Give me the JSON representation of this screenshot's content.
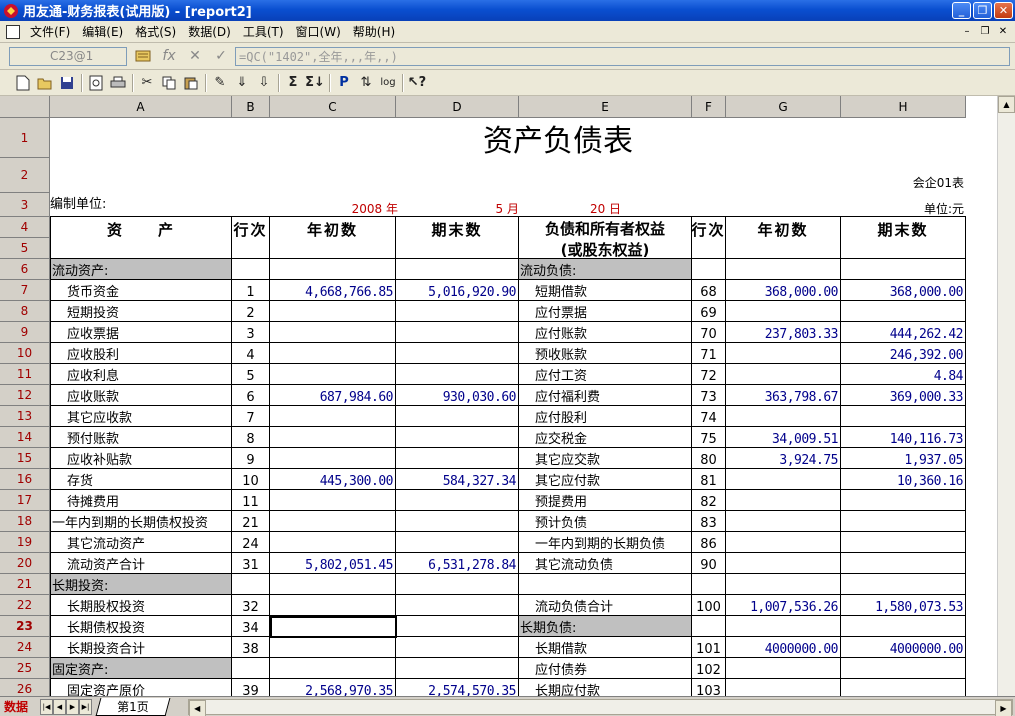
{
  "window": {
    "title": "用友通-财务报表(试用版) - [report2]",
    "buttons": [
      "_",
      "❐",
      "✕"
    ]
  },
  "menu": {
    "items": [
      "文件(F)",
      "编辑(E)",
      "格式(S)",
      "数据(D)",
      "工具(T)",
      "窗口(W)",
      "帮助(H)"
    ],
    "mdi_buttons": [
      "–",
      "❐",
      "✕"
    ]
  },
  "formula": {
    "cell_ref": "C23@1",
    "text": "=QC(\"1402\",全年,,,年,,)"
  },
  "sheet": {
    "columns": [
      "A",
      "B",
      "C",
      "D",
      "E",
      "F",
      "G",
      "H"
    ],
    "report_title": "资产负债表",
    "form_code": "会企01表",
    "unit_label": "编制单位:",
    "year": "2008 年",
    "month": "5 月",
    "day": "20 日",
    "currency_unit": "单位:元",
    "headers": {
      "assets": "资　　产",
      "line_no": "行次",
      "opening": "年初数",
      "closing": "期末数",
      "liabilities_line1": "负债和所有者权益",
      "liabilities_line2": "(或股东权益)"
    },
    "rows": [
      {
        "r": "6",
        "a": "流动资产:",
        "a_sec": true,
        "e": "流动负债:",
        "e_sec": true
      },
      {
        "r": "7",
        "a": "货币资金",
        "b": "1",
        "c": "4,668,766.85",
        "d": "5,016,920.90",
        "e": "短期借款",
        "f": "68",
        "g": "368,000.00",
        "h": "368,000.00"
      },
      {
        "r": "8",
        "a": "短期投资",
        "b": "2",
        "e": "应付票据",
        "f": "69"
      },
      {
        "r": "9",
        "a": "应收票据",
        "b": "3",
        "e": "应付账款",
        "f": "70",
        "g": "237,803.33",
        "h": "444,262.42"
      },
      {
        "r": "10",
        "a": "应收股利",
        "b": "4",
        "e": "预收账款",
        "f": "71",
        "h": "246,392.00"
      },
      {
        "r": "11",
        "a": "应收利息",
        "b": "5",
        "e": "应付工资",
        "f": "72",
        "h": "4.84"
      },
      {
        "r": "12",
        "a": "应收账款",
        "b": "6",
        "c": "687,984.60",
        "d": "930,030.60",
        "e": "应付福利费",
        "f": "73",
        "g": "363,798.67",
        "h": "369,000.33"
      },
      {
        "r": "13",
        "a": "其它应收款",
        "b": "7",
        "e": "应付股利",
        "f": "74"
      },
      {
        "r": "14",
        "a": "预付账款",
        "b": "8",
        "e": "应交税金",
        "f": "75",
        "g": "34,009.51",
        "h": "140,116.73"
      },
      {
        "r": "15",
        "a": "应收补贴款",
        "b": "9",
        "e": "其它应交款",
        "f": "80",
        "g": "3,924.75",
        "h": "1,937.05"
      },
      {
        "r": "16",
        "a": "存货",
        "b": "10",
        "c": "445,300.00",
        "d": "584,327.34",
        "e": "其它应付款",
        "f": "81",
        "h": "10,360.16"
      },
      {
        "r": "17",
        "a": "待摊费用",
        "b": "11",
        "e": "预提费用",
        "f": "82"
      },
      {
        "r": "18",
        "a": "一年内到期的长期债权投资",
        "a_flush": true,
        "b": "21",
        "e": "预计负债",
        "f": "83"
      },
      {
        "r": "19",
        "a": "其它流动资产",
        "b": "24",
        "e": "一年内到期的长期负债",
        "f": "86"
      },
      {
        "r": "20",
        "a": "流动资产合计",
        "b": "31",
        "c": "5,802,051.45",
        "d": "6,531,278.84",
        "e": "其它流动负债",
        "f": "90"
      },
      {
        "r": "21",
        "a": "长期投资:",
        "a_sec": true
      },
      {
        "r": "22",
        "a": "长期股权投资",
        "b": "32",
        "e": "流动负债合计",
        "f": "100",
        "g": "1,007,536.26",
        "h": "1,580,073.53"
      },
      {
        "r": "23",
        "a": "长期债权投资",
        "b": "34",
        "e": "长期负债:",
        "e_sec": true
      },
      {
        "r": "24",
        "a": "长期投资合计",
        "b": "38",
        "e": "长期借款",
        "f": "101",
        "g": "4000000.00",
        "h": "4000000.00"
      },
      {
        "r": "25",
        "a": "固定资产:",
        "a_sec": true,
        "e": "应付债券",
        "f": "102"
      },
      {
        "r": "26",
        "a": "固定资产原价",
        "b": "39",
        "c": "2,568,970.35",
        "d": "2,574,570.35",
        "e": "长期应付款",
        "f": "103"
      }
    ]
  },
  "status": {
    "mode": "数据",
    "sheet_tab": "第1页"
  }
}
